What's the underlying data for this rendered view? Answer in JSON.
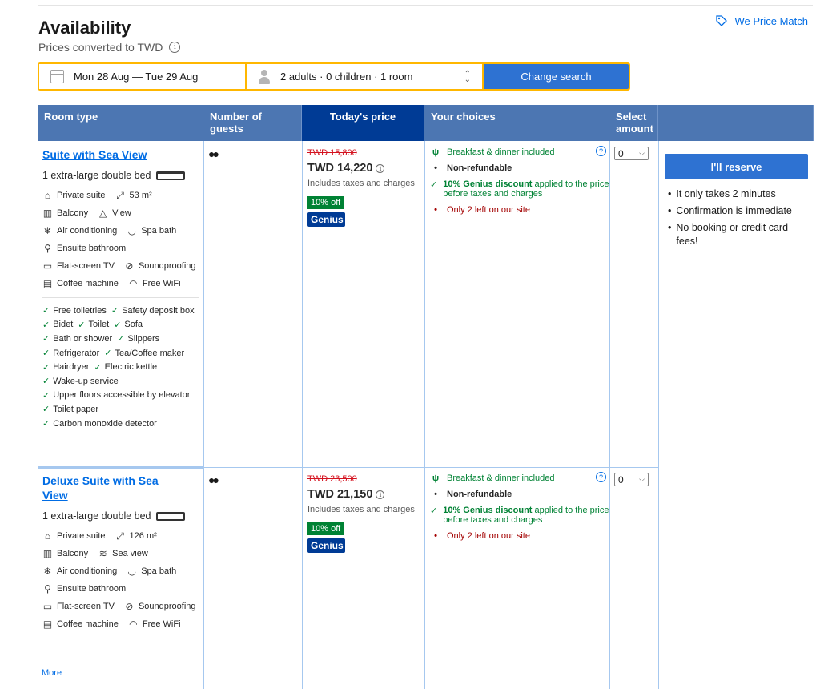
{
  "header": {
    "title": "Availability",
    "subtitle": "Prices converted to TWD",
    "price_match": "We Price Match"
  },
  "search": {
    "dates": "Mon 28 Aug — Tue 29 Aug",
    "guests": "2 adults · 0 children · 1 room",
    "button": "Change search"
  },
  "table": {
    "headers": {
      "room_type": "Room type",
      "guests": "Number of guests",
      "price": "Today's price",
      "choices": "Your choices",
      "select1": "Select",
      "select2": "amount"
    }
  },
  "rooms": [
    {
      "name": "Suite with Sea View",
      "bed": "1 extra-large double bed",
      "features": [
        {
          "icon": "home-icon",
          "glyph": "⌂",
          "label": "Private suite"
        },
        {
          "icon": "size-icon",
          "glyph": "⤢",
          "label": "53 m²"
        },
        {
          "icon": "balcony-icon",
          "glyph": "▥",
          "label": "Balcony"
        },
        {
          "icon": "mountain-icon",
          "glyph": "△",
          "label": "View"
        },
        {
          "icon": "snowflake-icon",
          "glyph": "❄",
          "label": "Air conditioning"
        },
        {
          "icon": "bath-icon",
          "glyph": "◡",
          "label": "Spa bath"
        },
        {
          "icon": "shower-icon",
          "glyph": "⚲",
          "label": "Ensuite bathroom"
        },
        {
          "icon": "tv-icon",
          "glyph": "▭",
          "label": "Flat-screen TV"
        },
        {
          "icon": "soundproof-icon",
          "glyph": "⊘",
          "label": "Soundproofing"
        },
        {
          "icon": "coffee-icon",
          "glyph": "▤",
          "label": "Coffee machine"
        },
        {
          "icon": "wifi-icon",
          "glyph": "◠",
          "label": "Free WiFi"
        }
      ],
      "checks": [
        "Free toiletries",
        "Safety deposit box",
        "Bidet",
        "Toilet",
        "Sofa",
        "Bath or shower",
        "Slippers",
        "Refrigerator",
        "Tea/Coffee maker",
        "Hairdryer",
        "Electric kettle",
        "Wake-up service",
        "Upper floors accessible by elevator",
        "Toilet paper",
        "Carbon monoxide detector"
      ],
      "old_price": "TWD 15,800",
      "price": "TWD 14,220",
      "taxes": "Includes taxes and charges",
      "discount_badge": "10% off",
      "genius_badge": "Genius",
      "meal": "Breakfast & dinner included",
      "refund": "Non-refundable",
      "genius_bold": "10% Genius discount",
      "genius_rest": " applied to the price before taxes and charges",
      "left": "Only 2 left on our site",
      "amount": "0"
    },
    {
      "name": "Deluxe Suite with Sea View",
      "bed": "1 extra-large double bed",
      "features": [
        {
          "icon": "home-icon",
          "glyph": "⌂",
          "label": "Private suite"
        },
        {
          "icon": "size-icon",
          "glyph": "⤢",
          "label": "126 m²"
        },
        {
          "icon": "balcony-icon",
          "glyph": "▥",
          "label": "Balcony"
        },
        {
          "icon": "sea-icon",
          "glyph": "≋",
          "label": "Sea view"
        },
        {
          "icon": "snowflake-icon",
          "glyph": "❄",
          "label": "Air conditioning"
        },
        {
          "icon": "bath-icon",
          "glyph": "◡",
          "label": "Spa bath"
        },
        {
          "icon": "shower-icon",
          "glyph": "⚲",
          "label": "Ensuite bathroom"
        },
        {
          "icon": "tv-icon",
          "glyph": "▭",
          "label": "Flat-screen TV"
        },
        {
          "icon": "soundproof-icon",
          "glyph": "⊘",
          "label": "Soundproofing"
        },
        {
          "icon": "coffee-icon",
          "glyph": "▤",
          "label": "Coffee machine"
        },
        {
          "icon": "wifi-icon",
          "glyph": "◠",
          "label": "Free WiFi"
        }
      ],
      "more": "More",
      "old_price": "TWD 23,500",
      "price": "TWD 21,150",
      "taxes": "Includes taxes and charges",
      "discount_badge": "10% off",
      "genius_badge": "Genius",
      "meal": "Breakfast & dinner included",
      "refund": "Non-refundable",
      "genius_bold": "10% Genius discount",
      "genius_rest": " applied to the price before taxes and charges",
      "left": "Only 2 left on our site",
      "amount": "0"
    }
  ],
  "reserve": {
    "button": "I'll reserve",
    "points": [
      "It only takes 2 minutes",
      "Confirmation is immediate",
      "No booking or credit card fees!"
    ]
  }
}
